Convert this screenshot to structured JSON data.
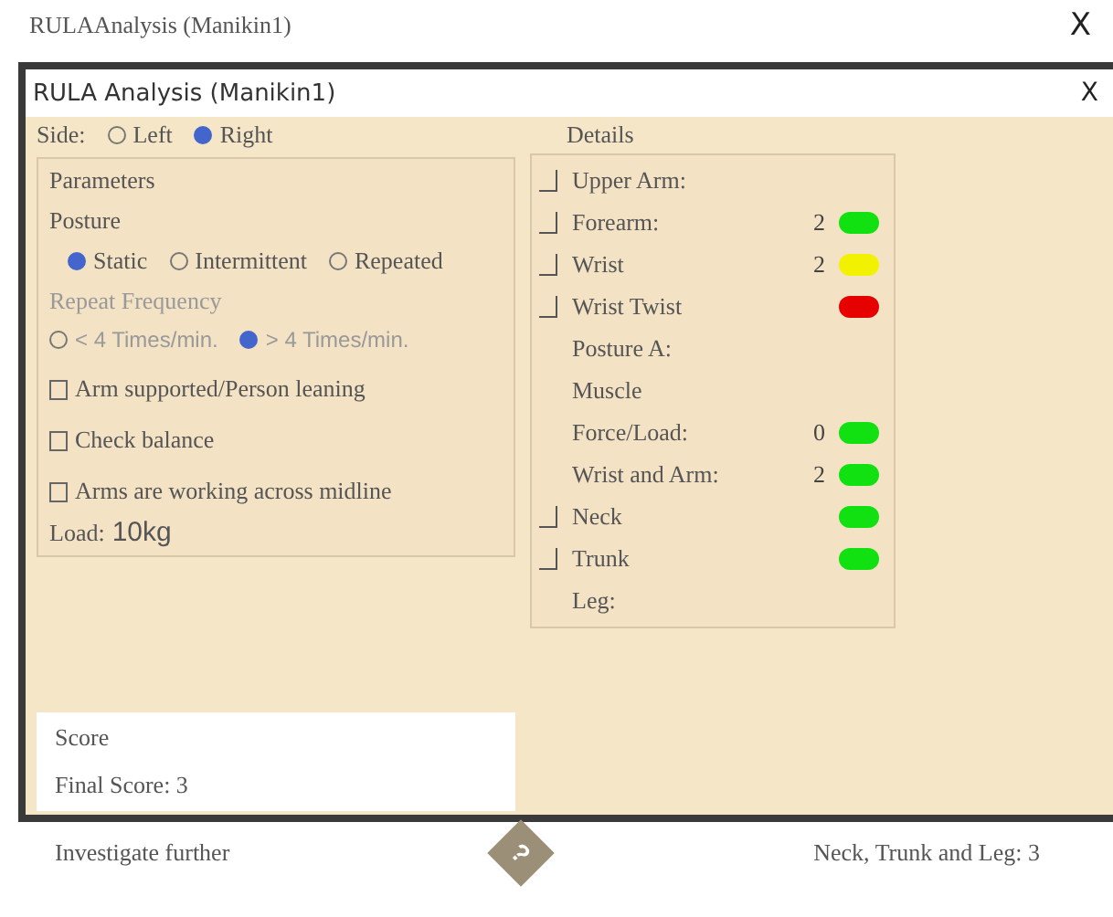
{
  "window": {
    "title": "RULAAnalysis (Manikin1)",
    "close": "X"
  },
  "dialog": {
    "title": "RULA Analysis (Manikin1)",
    "close": "X"
  },
  "side": {
    "label": "Side:",
    "options": [
      {
        "label": "Left",
        "selected": false
      },
      {
        "label": "Right",
        "selected": true
      }
    ]
  },
  "parameters": {
    "title": "Parameters",
    "posture": {
      "label": "Posture",
      "options": [
        {
          "label": "Static",
          "selected": true
        },
        {
          "label": "Intermittent",
          "selected": false
        },
        {
          "label": "Repeated",
          "selected": false
        }
      ]
    },
    "repeat_frequency": {
      "label": "Repeat Frequency",
      "options": [
        {
          "label": "< 4 Times/min.",
          "selected": false
        },
        {
          "label": "> 4 Times/min.",
          "selected": true
        }
      ]
    },
    "checks": [
      {
        "label": "Arm supported/Person leaning",
        "checked": false
      },
      {
        "label": "Check balance",
        "checked": false
      },
      {
        "label": "Arms are working across  midline",
        "checked": false
      }
    ],
    "load": {
      "label": "Load:",
      "value": "10kg"
    }
  },
  "score": {
    "title": "Score",
    "final": "Final Score: 3",
    "advice": "Investigate further"
  },
  "details": {
    "title": "Details",
    "rows": [
      {
        "label": "Upper Arm:",
        "toggle": true
      },
      {
        "label": "Forearm:",
        "toggle": true,
        "score": "2",
        "color": "#11e011"
      },
      {
        "label": "Wrist",
        "toggle": true,
        "score": "2",
        "color": "#f2f200"
      },
      {
        "label": "Wrist Twist",
        "toggle": true,
        "color": "#e60000"
      },
      {
        "label": "Posture A:",
        "toggle": false
      },
      {
        "label": "Muscle",
        "toggle": false
      },
      {
        "label": "Force/Load:",
        "toggle": false,
        "score": "0",
        "color": "#11e011"
      },
      {
        "label": "Wrist and Arm:",
        "toggle": false,
        "score": "2",
        "color": "#11e011"
      },
      {
        "label": "Neck",
        "toggle": true,
        "color": "#11e011"
      },
      {
        "label": "Trunk",
        "toggle": true,
        "color": "#11e011"
      },
      {
        "label": "Leg:",
        "toggle": false
      }
    ],
    "summary": "Neck, Trunk and Leg: 3"
  },
  "help": "?"
}
